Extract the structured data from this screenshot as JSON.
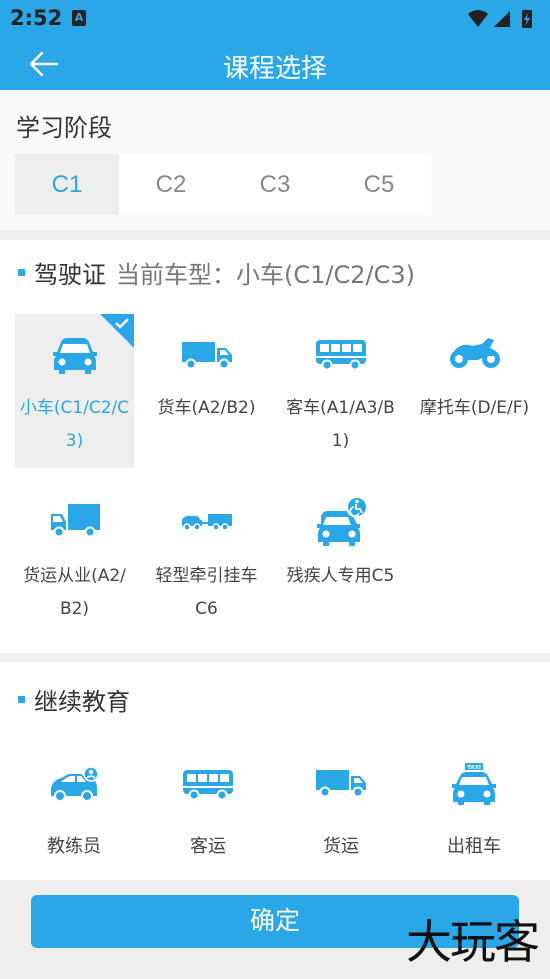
{
  "status": {
    "time": "2:52",
    "notif_letter": "A"
  },
  "header": {
    "title": "课程选择"
  },
  "stage": {
    "title": "学习阶段",
    "tabs": [
      {
        "label": "C1",
        "active": true
      },
      {
        "label": "C2",
        "active": false
      },
      {
        "label": "C3",
        "active": false
      },
      {
        "label": "C5",
        "active": false
      }
    ]
  },
  "license": {
    "title": "驾驶证",
    "current": "当前车型：小车(C1/C2/C3)",
    "items": [
      {
        "label": "小车(C1/C2/C3)",
        "icon": "car-icon",
        "selected": true
      },
      {
        "label": "货车(A2/B2)",
        "icon": "truck-icon",
        "selected": false
      },
      {
        "label": "客车(A1/A3/B1)",
        "icon": "bus-icon",
        "selected": false
      },
      {
        "label": "摩托车(D/E/F)",
        "icon": "motorcycle-icon",
        "selected": false
      },
      {
        "label": "货运从业(A2/B2)",
        "icon": "cargo-truck-icon",
        "selected": false
      },
      {
        "label": "轻型牵引挂车C6",
        "icon": "tow-trailer-icon",
        "selected": false
      },
      {
        "label": "残疾人专用C5",
        "icon": "accessible-car-icon",
        "selected": false
      }
    ]
  },
  "education": {
    "title": "继续教育",
    "items": [
      {
        "label": "教练员",
        "icon": "coach-car-icon"
      },
      {
        "label": "客运",
        "icon": "bus-icon"
      },
      {
        "label": "货运",
        "icon": "truck-icon"
      },
      {
        "label": "出租车",
        "icon": "taxi-icon"
      }
    ]
  },
  "footer": {
    "confirm_label": "确定",
    "watermark": "大玩客"
  },
  "colors": {
    "primary": "#2aa7e6",
    "background": "#eeeeee"
  }
}
